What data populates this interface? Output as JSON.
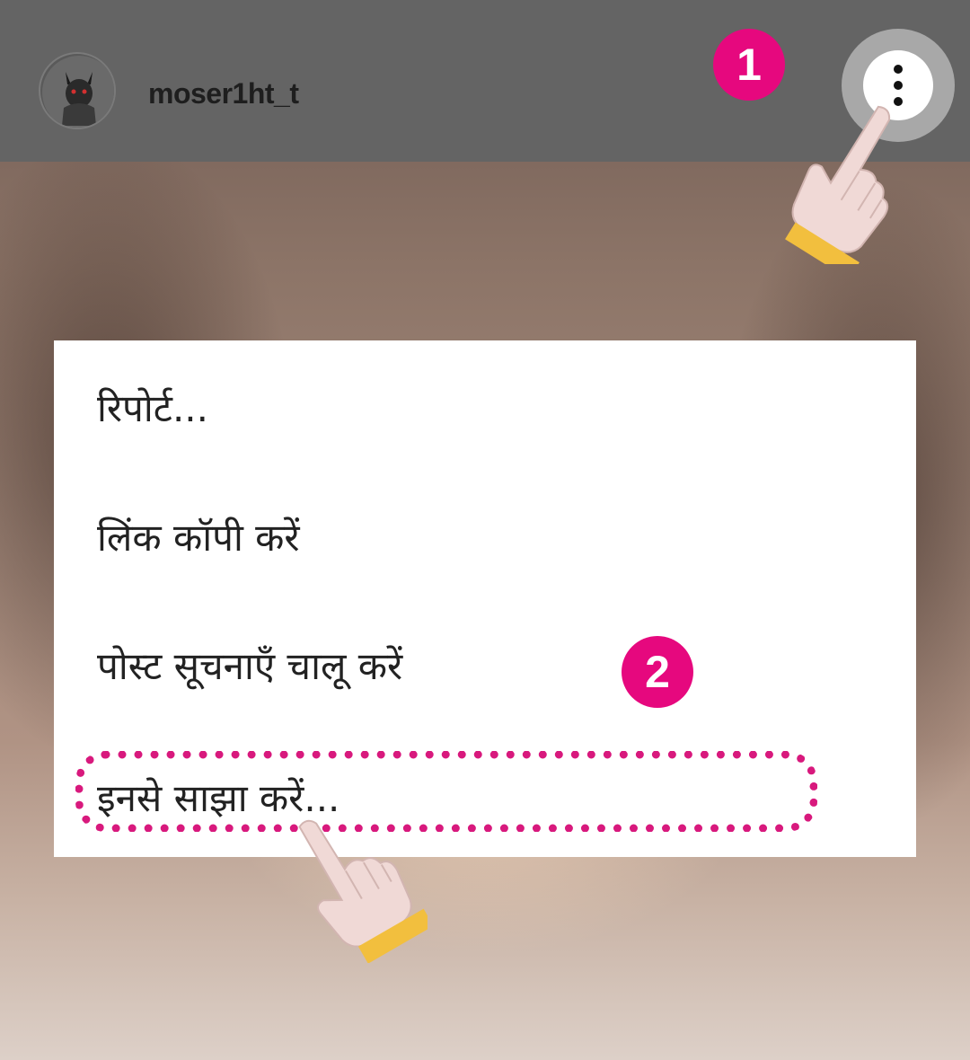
{
  "header": {
    "username": "moser1ht_t"
  },
  "annotations": {
    "step_1": "1",
    "step_2": "2",
    "badge_color": "#e6087e",
    "highlight_color": "#d8197d"
  },
  "menu": {
    "items": [
      {
        "label": "रिपोर्ट..."
      },
      {
        "label": "लिंक कॉपी करें"
      },
      {
        "label": "पोस्ट सूचनाएँ चालू करें"
      },
      {
        "label": "इनसे साझा करें..."
      }
    ]
  },
  "icons": {
    "more": "vertical-dots-icon",
    "pointer": "pointing-hand-icon"
  }
}
